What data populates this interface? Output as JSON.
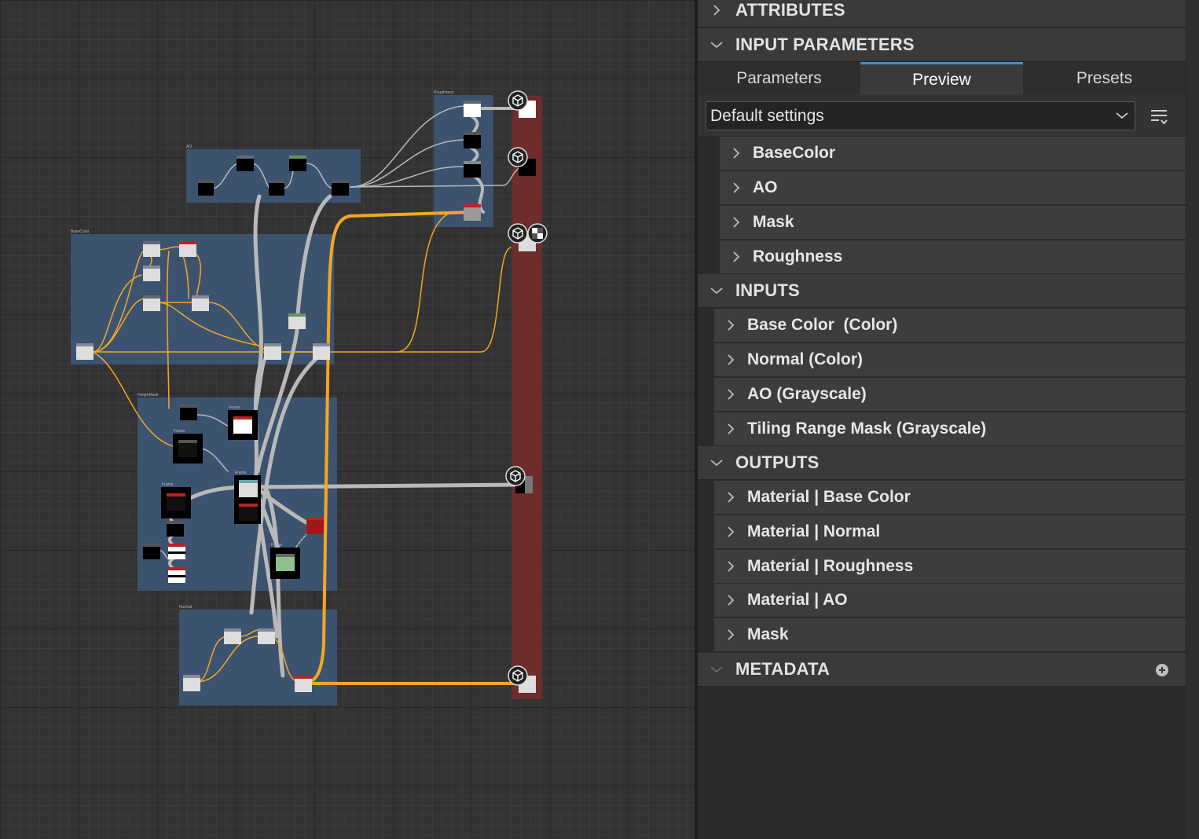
{
  "panel": {
    "attributes": {
      "label": "ATTRIBUTES"
    },
    "input_parameters": {
      "label": "INPUT PARAMETERS",
      "tabs": [
        {
          "label": "Parameters",
          "active": false
        },
        {
          "label": "Preview",
          "active": true
        },
        {
          "label": "Presets",
          "active": false
        }
      ],
      "preset_dropdown": {
        "value": "Default settings"
      },
      "groups": [
        "BaseColor",
        "AO",
        "Mask",
        "Roughness"
      ]
    },
    "inputs": {
      "label": "INPUTS",
      "items": [
        "Base Color  (Color)",
        "Normal (Color)",
        "AO (Grayscale)",
        "Tiling Range Mask (Grayscale)"
      ]
    },
    "outputs": {
      "label": "OUTPUTS",
      "items": [
        "Material | Base Color",
        "Material | Normal",
        "Material | Roughness",
        "Material | AO",
        "Mask"
      ]
    },
    "metadata": {
      "label": "METADATA"
    }
  },
  "graph": {
    "frames": [
      "AO",
      "BaseColor",
      "HeightMask",
      "Normal",
      "Roughness"
    ],
    "node_titles": [
      "Frame"
    ],
    "colors": {
      "frame_blue": "#3d5675",
      "output_frame_red": "#6e2c2c",
      "link_orange": "#f5a623",
      "link_gray": "#b9b9b9",
      "accent_tab": "#3b8fd8"
    }
  }
}
